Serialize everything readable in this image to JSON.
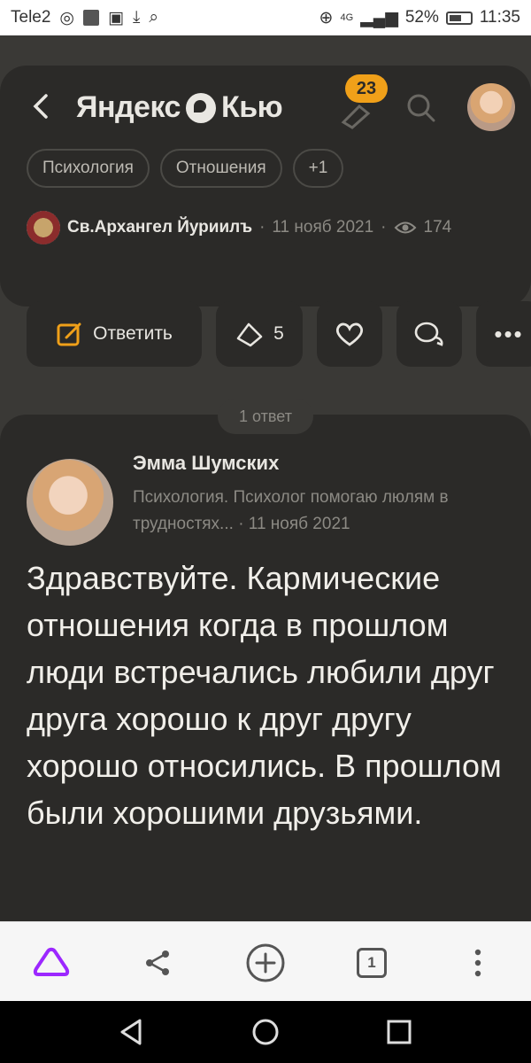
{
  "status": {
    "carrier": "Tele2",
    "battery": "52%",
    "time": "11:35",
    "network": "4G"
  },
  "app": {
    "brand": "Яндекс",
    "brand2": "Кью",
    "notifications": "23"
  },
  "question": {
    "tags": [
      "Психология",
      "Отношения",
      "+1"
    ],
    "author": "Св.Архангел Йуриилъ",
    "date": "11 нояб 2021",
    "views": "174"
  },
  "actions": {
    "reply_label": "Ответить",
    "upvotes": "5"
  },
  "answers_count_label": "1 ответ",
  "answer": {
    "author": "Эмма Шумских",
    "description": "Психология. Психолог помогаю люлям в трудностях...",
    "date": "11 нояб 2021",
    "text": "Здравствуйте. Кармические отношения когда в прошлом люди встречались любили друг друга хорошо к друг другу хорошо относились. В прошлом были хорошими друзьями."
  },
  "browser": {
    "tabs_count": "1"
  },
  "colors": {
    "accent": "#f0a019",
    "bg_dark": "#2b2a28",
    "page_bg": "#3a3936",
    "alice": "#9c27ff"
  }
}
